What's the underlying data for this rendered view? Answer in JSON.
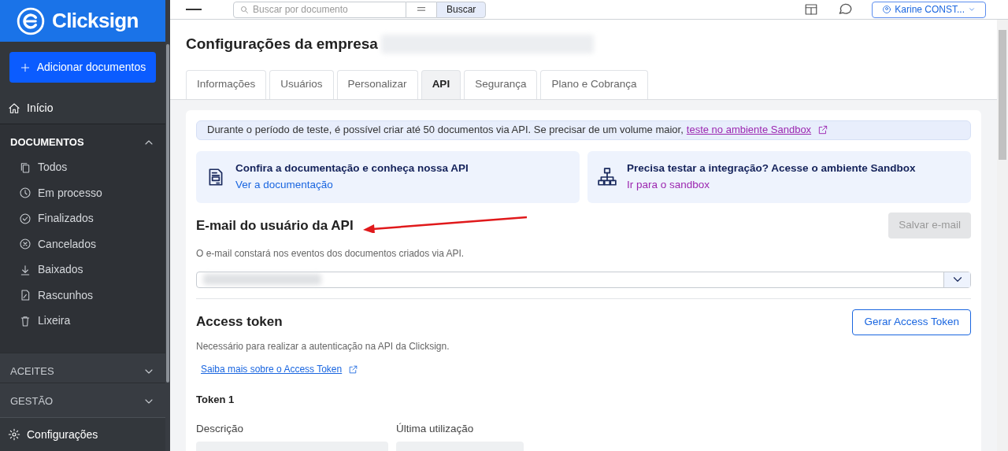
{
  "sidebar": {
    "logo": "Clicksign",
    "add_button": "Adicionar documentos",
    "home": {
      "label": "Início",
      "selected": false
    },
    "sections": [
      {
        "title": "DOCUMENTOS",
        "expanded": true,
        "items": [
          {
            "label": "Todos"
          },
          {
            "label": "Em processo"
          },
          {
            "label": "Finalizados"
          },
          {
            "label": "Cancelados"
          },
          {
            "label": "Baixados"
          },
          {
            "label": "Rascunhos"
          },
          {
            "label": "Lixeira"
          }
        ]
      },
      {
        "title": "ACEITES",
        "expanded": false
      },
      {
        "title": "GESTÃO",
        "expanded": false
      }
    ],
    "settings": "Configurações"
  },
  "header": {
    "search_placeholder": "Buscar por documento",
    "search_button": "Buscar",
    "user": "Karine CONST..."
  },
  "page": {
    "title": "Configurações da empresa",
    "tabs": [
      {
        "label": "Informações",
        "selected": false
      },
      {
        "label": "Usuários",
        "selected": false
      },
      {
        "label": "Personalizar",
        "selected": false
      },
      {
        "label": "API",
        "selected": true
      },
      {
        "label": "Segurança",
        "selected": false
      },
      {
        "label": "Plano e Cobrança",
        "selected": false
      }
    ],
    "notice": {
      "text": "Durante o período de teste, é possível criar até 50 documentos via API. Se precisar de um volume maior,",
      "link": "teste no ambiente Sandbox"
    },
    "cards": [
      {
        "title": "Confira a documentação e conheça nossa API",
        "link": "Ver a documentação"
      },
      {
        "title": "Precisa testar a integração? Acesse o ambiente Sandbox",
        "link": "Ir para o sandbox"
      }
    ],
    "email_section": {
      "title": "E-mail do usuário da API",
      "save_button": "Salvar e-mail",
      "save_disabled": true,
      "hint": "O e-mail constará nos eventos dos documentos criados via API."
    },
    "token_section": {
      "title": "Access token",
      "button": "Gerar Access Token",
      "description": "Necessário para realizar a autenticação na API da Clicksign.",
      "link": "Saiba mais sobre o Access Token",
      "token": {
        "title": "Token 1",
        "columns": [
          "Descrição",
          "Última utilização"
        ]
      }
    }
  }
}
